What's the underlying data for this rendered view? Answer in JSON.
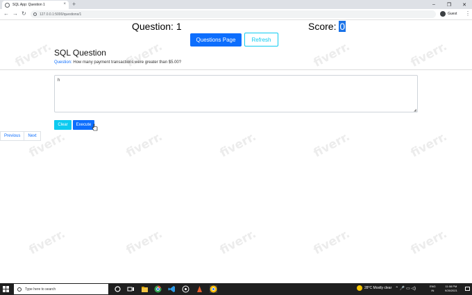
{
  "browser": {
    "tab_title": "SQL App: Question 1",
    "tab_close": "×",
    "new_tab": "+",
    "url": "127.0.0.1:5000/questions/1",
    "profile_name": "Guest",
    "win_minimize": "–",
    "win_restore": "❐",
    "win_close": "✕",
    "back": "←",
    "forward": "→",
    "reload": "↻",
    "menu": "⋮"
  },
  "header": {
    "question_title": "Question: 1",
    "score_label": "Score: ",
    "score_value": "0"
  },
  "actions": {
    "questions_page": "Questions Page",
    "refresh": "Refresh"
  },
  "sql": {
    "title": "SQL Question",
    "question_label": "Question:",
    "question_text": " How many payment transactions were greater than $5.00?",
    "input_value": "h"
  },
  "buttons": {
    "clear": "Clear",
    "execute": "Execute"
  },
  "pager": {
    "previous": "Previous",
    "next": "Next"
  },
  "watermark": "fiverr.",
  "taskbar": {
    "search_placeholder": "Type here to search",
    "weather": "28°C  Mostly clear",
    "tray_symbols": "⌃ 🎤 ▭ ◁) ",
    "lang_top": "ENG",
    "lang_bottom": "IN",
    "time": "11:08 PM",
    "date": "9/26/2021"
  },
  "colors": {
    "primary": "#0d6efd",
    "info": "#0dcaf0",
    "score_highlight": "#1a73e8",
    "taskbar": "#1f1f1f"
  }
}
